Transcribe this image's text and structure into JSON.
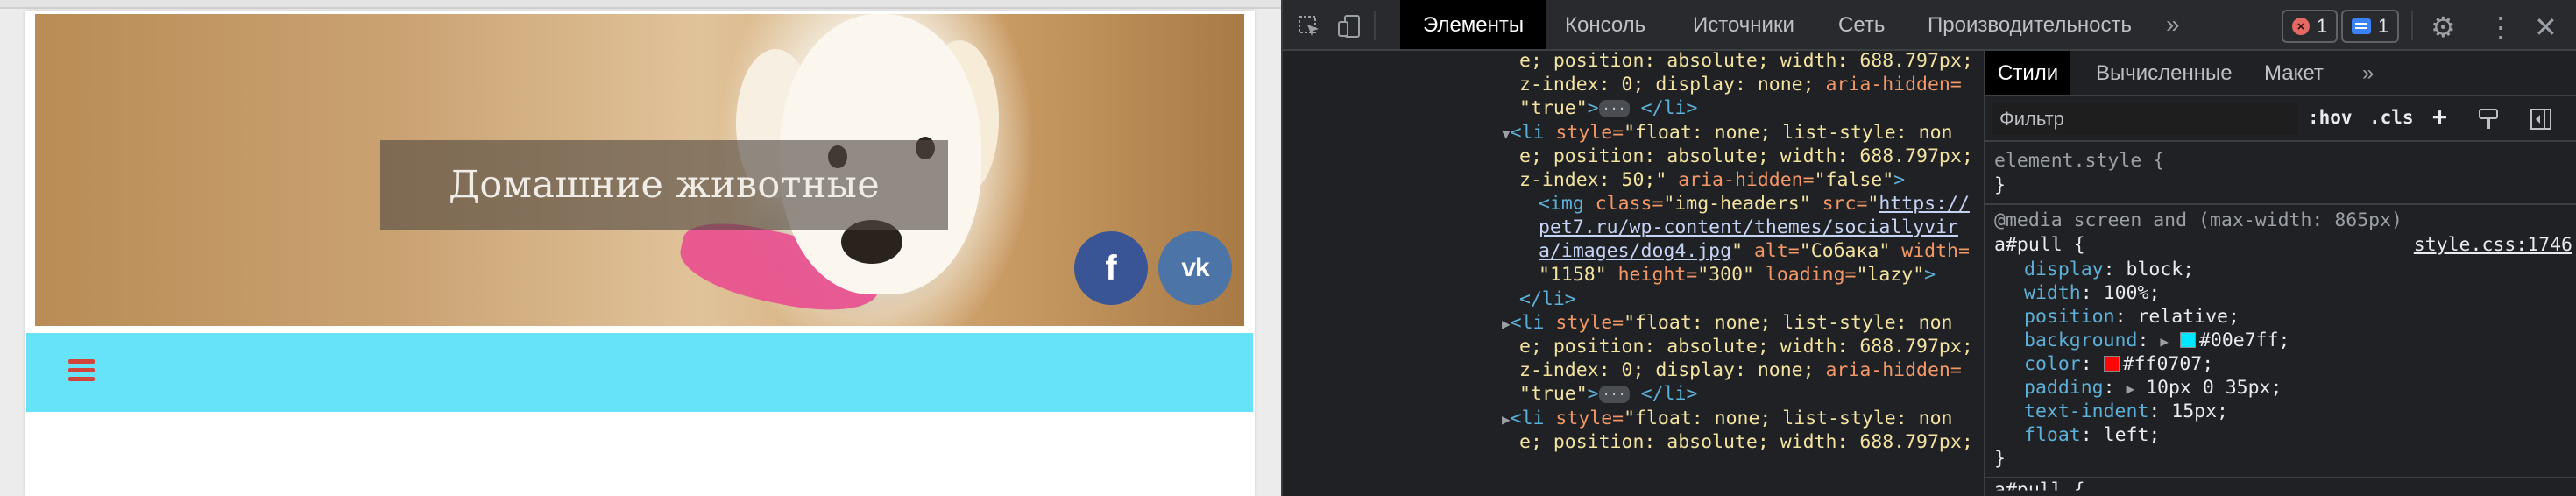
{
  "website": {
    "site_title": "Домашние животные",
    "social": {
      "facebook_label": "f",
      "vk_label": "vk"
    },
    "nav": {
      "menu_icon": "hamburger-menu-icon",
      "bar_color": "#66e3f7",
      "icon_color": "#d2453b"
    }
  },
  "devtools": {
    "tabs": [
      "Элементы",
      "Консоль",
      "Источники",
      "Сеть",
      "Производительность"
    ],
    "more_tabs": "»",
    "error_count": "1",
    "message_count": "1",
    "elements": {
      "l1": {
        "prefix": "e; position: absolute; width: 688.797px;"
      },
      "l2": {
        "text": "z-index: 0; display: none;",
        "attr": " aria-hidden="
      },
      "l3": {
        "val": "\"true\"",
        "close": " </li>"
      },
      "l4": {
        "open": "<li",
        "attr": " style=",
        "val": "\"float: none; list-style: non"
      },
      "l5": {
        "text": "e; position: absolute; width: 688.797px;"
      },
      "l6": {
        "text": "z-index: 50;\"",
        "attr": " aria-hidden=",
        "val": "\"false\"",
        "close": ">"
      },
      "l7": {
        "open": "<img",
        "attr1": " class=",
        "val1": "\"img-headers\"",
        "attr2": " src=",
        "val2": "\"",
        "link": "https://"
      },
      "l8": {
        "link": "pet7.ru/wp-content/themes/sociallyvir"
      },
      "l9": {
        "link": "a/images/dog4.jpg",
        "val": "\"",
        "attr1": " alt=",
        "val1": "\"Собака\"",
        "attr2": " width="
      },
      "l10": {
        "val1": "\"1158\"",
        "attr": " height=",
        "val2": "\"300\"",
        "attr2": " loading=",
        "val3": "\"lazy\"",
        "close": ">"
      },
      "l11": {
        "close": "</li>"
      },
      "l12": {
        "open": "<li",
        "attr": " style=",
        "val": "\"float: none; list-style: non"
      },
      "l13": {
        "text": "e; position: absolute; width: 688.797px;"
      },
      "l14": {
        "text": "z-index: 0; display: none;",
        "attr": " aria-hidden="
      },
      "l15": {
        "val": "\"true\"",
        "close": " </li>"
      },
      "l16": {
        "open": "<li",
        "attr": " style=",
        "val": "\"float: none; list-style: non"
      },
      "l17": {
        "text": "e; position: absolute; width: 688.797px;"
      }
    },
    "styles": {
      "tabs": [
        "Стили",
        "Вычисленные",
        "Макет"
      ],
      "more": "»",
      "filter_placeholder": "Фильтр",
      "hov": ":hov",
      "cls": ".cls",
      "add": "+",
      "element_style": "element.style {",
      "close_brace": "}",
      "media": "@media screen and (max-width: 865px)",
      "selector": "a#pull {",
      "source": "style.css:1746",
      "props": [
        {
          "name": "display",
          "value": "block;"
        },
        {
          "name": "width",
          "value": "100%;"
        },
        {
          "name": "position",
          "value": "relative;"
        },
        {
          "name": "background",
          "value": "#00e7ff;",
          "swatch": "#00e7ff"
        },
        {
          "name": "color",
          "value": "#ff0707;",
          "swatch": "#ff0707"
        },
        {
          "name": "padding",
          "value": "10px 0 35px;"
        },
        {
          "name": "text-indent",
          "value": "15px;"
        },
        {
          "name": "float",
          "value": "left;"
        }
      ],
      "partial_next": "a#pull {"
    }
  }
}
